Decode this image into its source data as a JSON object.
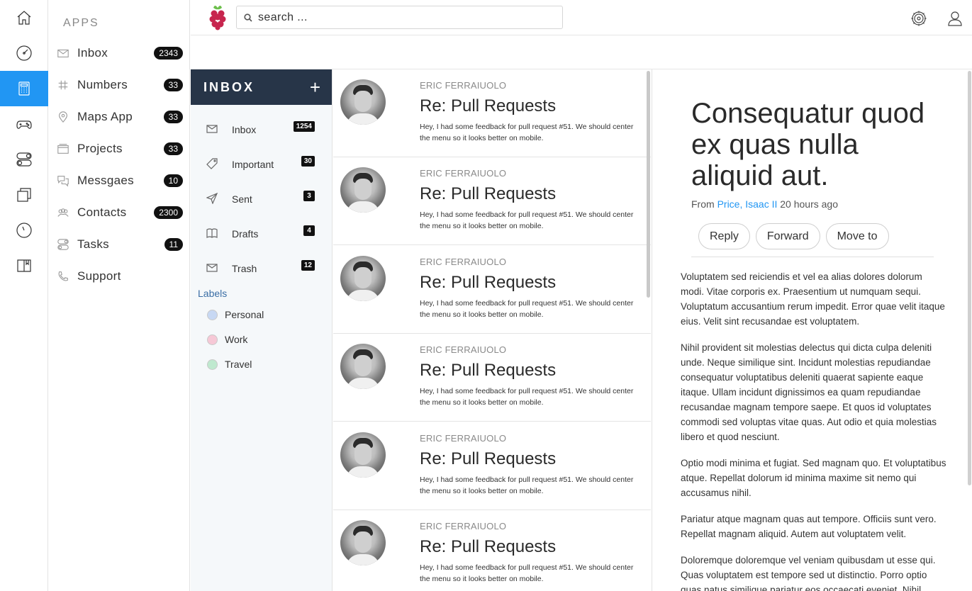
{
  "rail": {
    "items": [
      {
        "icon": "home-icon"
      },
      {
        "icon": "dashboard-icon"
      },
      {
        "icon": "calculator-icon",
        "active": true
      },
      {
        "icon": "gamepad-icon"
      },
      {
        "icon": "toggle-icon"
      },
      {
        "icon": "windows-icon"
      },
      {
        "icon": "clock-icon"
      },
      {
        "icon": "book-icon"
      }
    ],
    "accent_color": "#2196f3"
  },
  "apps": {
    "title": "APPS",
    "items": [
      {
        "label": "Inbox",
        "count": "2343",
        "icon": "mail-icon"
      },
      {
        "label": "Numbers",
        "count": "33",
        "icon": "hash-icon"
      },
      {
        "label": "Maps App",
        "count": "33",
        "icon": "map-pin-icon"
      },
      {
        "label": "Projects",
        "count": "33",
        "icon": "folder-icon"
      },
      {
        "label": "Messgaes",
        "count": "10",
        "icon": "chat-icon"
      },
      {
        "label": "Contacts",
        "count": "2300",
        "icon": "people-icon"
      },
      {
        "label": "Tasks",
        "count": "11",
        "icon": "toggle-icon"
      },
      {
        "label": "Support",
        "count": null,
        "icon": "phone-icon"
      }
    ]
  },
  "topbar": {
    "search_placeholder": "search ...",
    "logo": "raspberry-logo",
    "icons": [
      "settings-icon",
      "user-icon"
    ]
  },
  "folders": {
    "title": "INBOX",
    "add_label": "+",
    "items": [
      {
        "label": "Inbox",
        "count": "1254",
        "icon": "mail-icon"
      },
      {
        "label": "Important",
        "count": "30",
        "icon": "tag-icon"
      },
      {
        "label": "Sent",
        "count": "3",
        "icon": "send-icon"
      },
      {
        "label": "Drafts",
        "count": "4",
        "icon": "book-icon"
      },
      {
        "label": "Trash",
        "count": "12",
        "icon": "mail-icon"
      }
    ],
    "labels_title": "Labels",
    "labels": [
      {
        "label": "Personal",
        "color": "#c7d8f3"
      },
      {
        "label": "Work",
        "color": "#f6c8d6"
      },
      {
        "label": "Travel",
        "color": "#bfe9cf"
      }
    ]
  },
  "messages": [
    {
      "from": "ERIC FERRAIUOLO",
      "subject": "Re: Pull Requests",
      "preview": "Hey, I had some feedback for pull request #51. We should center the menu so it looks better on mobile."
    },
    {
      "from": "ERIC FERRAIUOLO",
      "subject": "Re: Pull Requests",
      "preview": "Hey, I had some feedback for pull request #51. We should center the menu so it looks better on mobile."
    },
    {
      "from": "ERIC FERRAIUOLO",
      "subject": "Re: Pull Requests",
      "preview": "Hey, I had some feedback for pull request #51. We should center the menu so it looks better on mobile."
    },
    {
      "from": "ERIC FERRAIUOLO",
      "subject": "Re: Pull Requests",
      "preview": "Hey, I had some feedback for pull request #51. We should center the menu so it looks better on mobile."
    },
    {
      "from": "ERIC FERRAIUOLO",
      "subject": "Re: Pull Requests",
      "preview": "Hey, I had some feedback for pull request #51. We should center the menu so it looks better on mobile."
    },
    {
      "from": "ERIC FERRAIUOLO",
      "subject": "Re: Pull Requests",
      "preview": "Hey, I had some feedback for pull request #51. We should center the menu so it looks better on mobile."
    }
  ],
  "reader": {
    "title": "Consequatur quod ex quas nulla aliquid aut.",
    "from_prefix": "From",
    "sender": "Price, Isaac II",
    "time": "20 hours ago",
    "actions": [
      "Reply",
      "Forward",
      "Move to"
    ],
    "paragraphs": [
      "Voluptatem sed reiciendis et vel ea alias dolores dolorum modi. Vitae corporis ex. Praesentium ut numquam sequi. Voluptatum accusantium rerum impedit. Error quae velit itaque eius. Velit sint recusandae est voluptatem.",
      "Nihil provident sit molestias delectus qui dicta culpa deleniti unde. Neque similique sint. Incidunt molestias repudiandae consequatur voluptatibus deleniti quaerat sapiente eaque itaque. Ullam incidunt dignissimos ea quam repudiandae recusandae magnam tempore saepe. Et quos id voluptates commodi sed voluptas vitae quas. Aut odio et quia molestias libero et quod nesciunt.",
      "Optio modi minima et fugiat. Sed magnam quo. Et voluptatibus atque. Repellat dolorum id minima maxime sit nemo qui accusamus nihil.",
      "Pariatur atque magnam quas aut tempore. Officiis sunt vero. Repellat magnam aliquid. Autem aut voluptatem velit.",
      "Doloremque doloremque vel veniam quibusdam ut esse qui. Quas voluptatem est tempore sed ut distinctio. Porro optio quas natus similique pariatur eos occaecati eveniet. Nihil"
    ]
  }
}
